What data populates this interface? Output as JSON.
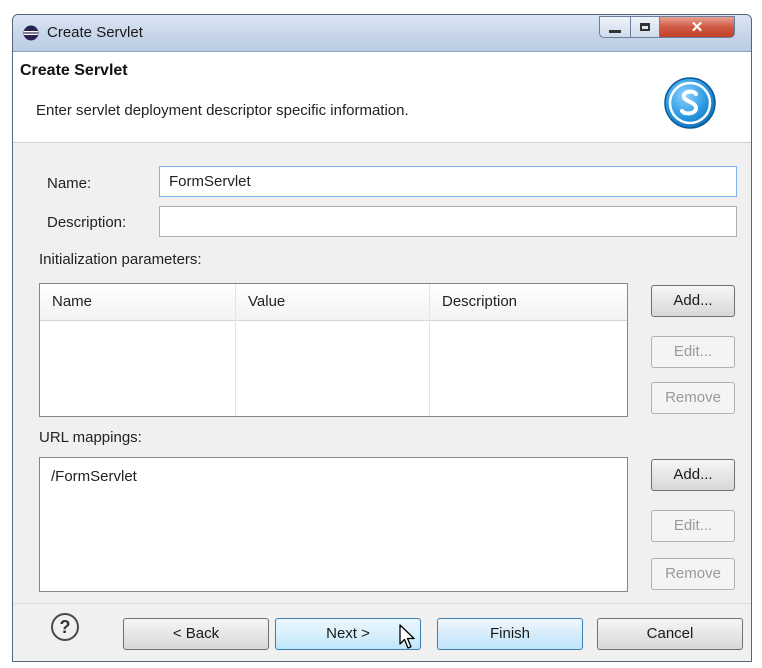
{
  "window": {
    "title": "Create Servlet"
  },
  "header": {
    "title": "Create Servlet",
    "description": "Enter servlet deployment descriptor specific information."
  },
  "form": {
    "name_label": "Name:",
    "name_value": "FormServlet",
    "description_label": "Description:",
    "description_value": ""
  },
  "init_params": {
    "label": "Initialization parameters:",
    "columns": [
      "Name",
      "Value",
      "Description"
    ],
    "rows": [],
    "buttons": {
      "add": "Add...",
      "edit": "Edit...",
      "remove": "Remove"
    }
  },
  "url_mappings": {
    "label": "URL mappings:",
    "items": [
      "/FormServlet"
    ],
    "buttons": {
      "add": "Add...",
      "edit": "Edit...",
      "remove": "Remove"
    }
  },
  "footer": {
    "help": "?",
    "back": "< Back",
    "next": "Next >",
    "finish": "Finish",
    "cancel": "Cancel"
  },
  "icons": {
    "window": "eclipse-icon",
    "logo": "servlet-logo-icon",
    "minimize": "minimize-icon",
    "maximize": "maximize-icon",
    "close": "close-icon",
    "help": "help-icon",
    "cursor": "mouse-cursor-icon"
  },
  "colors": {
    "accent": "#3c7fb1",
    "close": "#c23f28",
    "logo": "#1c8bd3"
  }
}
